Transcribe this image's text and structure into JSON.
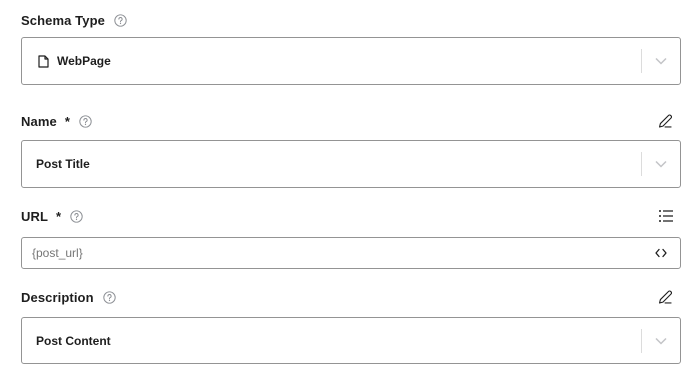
{
  "fields": {
    "schema_type": {
      "label": "Schema Type",
      "value": "WebPage"
    },
    "name": {
      "label": "Name",
      "required_mark": "*",
      "value": "Post Title"
    },
    "url": {
      "label": "URL",
      "required_mark": "*",
      "placeholder": "{post_url}"
    },
    "description": {
      "label": "Description",
      "value": "Post Content"
    }
  },
  "icons": {
    "help": "help-circle-icon",
    "document": "document-icon",
    "chevron": "chevron-down-icon",
    "edit": "pencil-icon",
    "list": "list-icon",
    "code": "code-icon"
  },
  "colors": {
    "text": "#1e1e1e",
    "border": "#949494",
    "icon_gray": "#8c8f94",
    "chevron": "#c3c4c7",
    "placeholder": "#757575"
  }
}
